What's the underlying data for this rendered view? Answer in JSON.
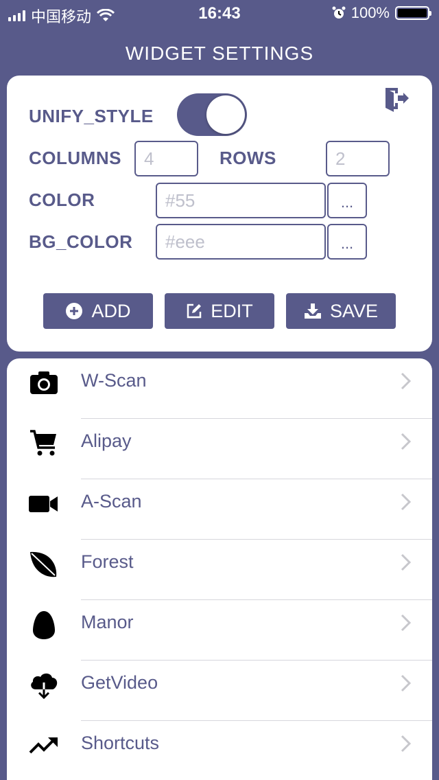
{
  "status": {
    "carrier": "中国移动",
    "time": "16:43",
    "battery": "100%"
  },
  "title": "WIDGET SETTINGS",
  "settings": {
    "unify_style_label": "UNIFY_STYLE",
    "unify_style_on": true,
    "columns_label": "COLUMNS",
    "columns_placeholder": "4",
    "rows_label": "ROWS",
    "rows_placeholder": "2",
    "color_label": "COLOR",
    "color_placeholder": "#55",
    "bg_color_label": "BG_COLOR",
    "bg_color_placeholder": "#eee",
    "picker_label": "..."
  },
  "actions": {
    "add": "ADD",
    "edit": "EDIT",
    "save": "SAVE"
  },
  "list": [
    {
      "label": "W-Scan",
      "icon": "camera-icon"
    },
    {
      "label": "Alipay",
      "icon": "cart-icon"
    },
    {
      "label": "A-Scan",
      "icon": "video-camera-icon"
    },
    {
      "label": "Forest",
      "icon": "leaf-icon"
    },
    {
      "label": "Manor",
      "icon": "egg-icon"
    },
    {
      "label": "GetVideo",
      "icon": "cloud-download-icon"
    },
    {
      "label": "Shortcuts",
      "icon": "trending-up-icon"
    }
  ],
  "colors": {
    "primary": "#585a8a",
    "background": "#ffffff"
  }
}
